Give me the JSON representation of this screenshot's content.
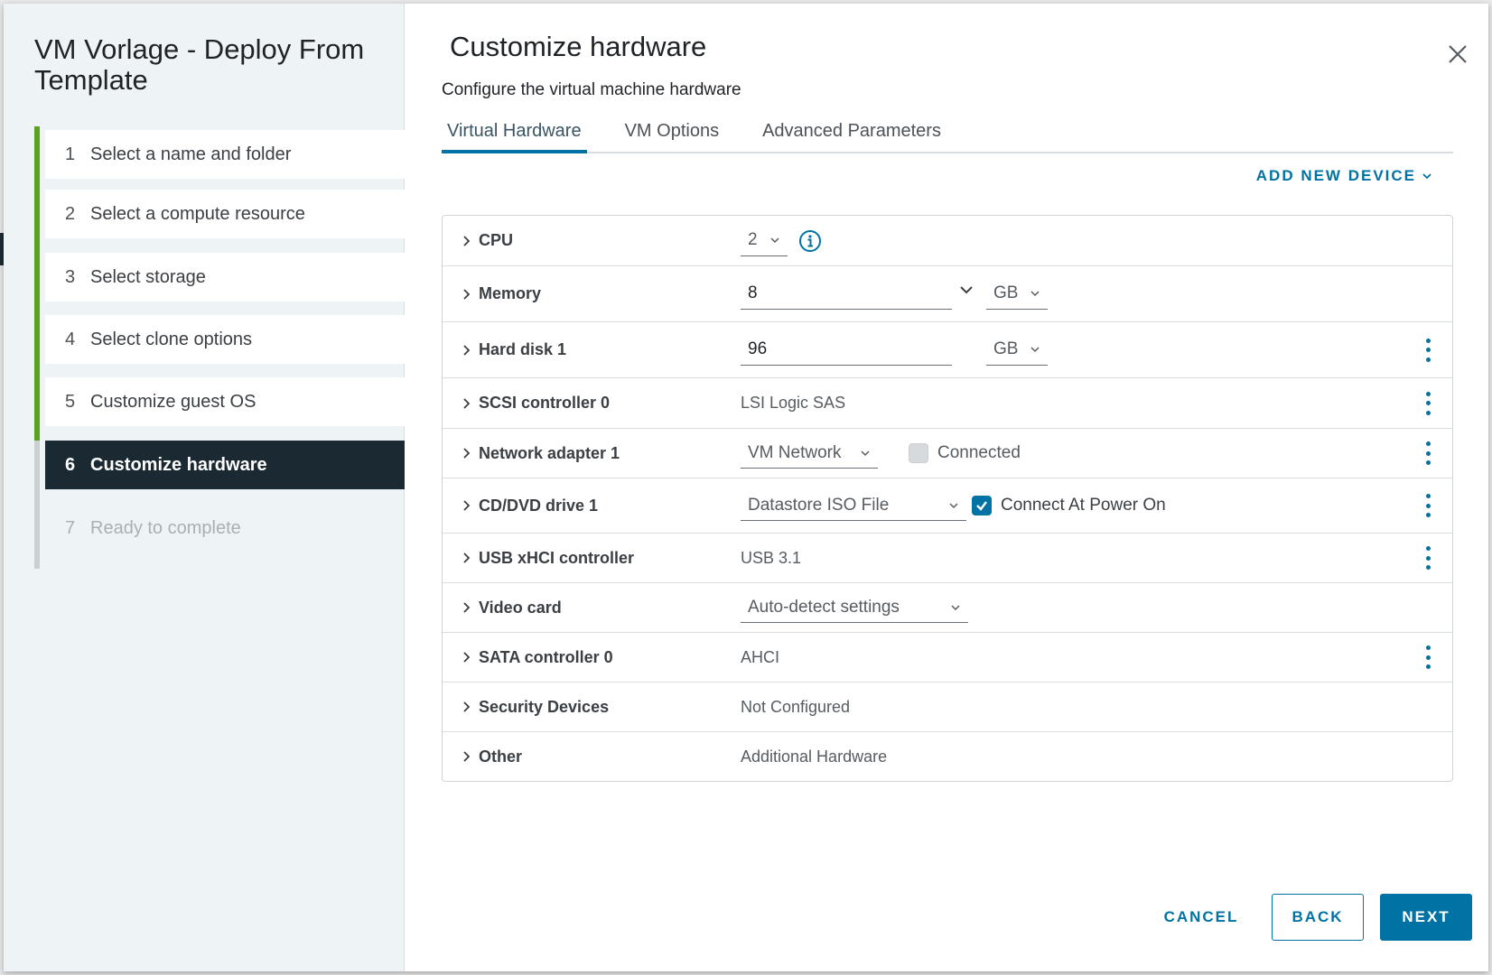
{
  "wizard": {
    "title": "VM Vorlage - Deploy From Template",
    "steps": [
      {
        "num": "1",
        "label": "Select a name and folder"
      },
      {
        "num": "2",
        "label": "Select a compute resource"
      },
      {
        "num": "3",
        "label": "Select storage"
      },
      {
        "num": "4",
        "label": "Select clone options"
      },
      {
        "num": "5",
        "label": "Customize guest OS"
      },
      {
        "num": "6",
        "label": "Customize hardware"
      },
      {
        "num": "7",
        "label": "Ready to complete"
      }
    ]
  },
  "main": {
    "title": "Customize hardware",
    "subtitle": "Configure the virtual machine hardware",
    "tabs": [
      "Virtual Hardware",
      "VM Options",
      "Advanced Parameters"
    ],
    "add_device": "ADD NEW DEVICE",
    "hardware": {
      "cpu": {
        "name": "CPU",
        "value": "2"
      },
      "memory": {
        "name": "Memory",
        "value": "8",
        "unit": "GB"
      },
      "hard_disk": {
        "name": "Hard disk 1",
        "value": "96",
        "unit": "GB"
      },
      "scsi": {
        "name": "SCSI controller 0",
        "value": "LSI Logic SAS"
      },
      "network": {
        "name": "Network adapter 1",
        "value": "VM Network",
        "checkbox_label": "Connected"
      },
      "cddvd": {
        "name": "CD/DVD drive 1",
        "value": "Datastore ISO File",
        "checkbox_label": "Connect At Power On"
      },
      "usb": {
        "name": "USB xHCI controller",
        "value": "USB 3.1"
      },
      "video": {
        "name": "Video card",
        "value": "Auto-detect settings"
      },
      "sata": {
        "name": "SATA controller 0",
        "value": "AHCI"
      },
      "security": {
        "name": "Security Devices",
        "value": "Not Configured"
      },
      "other": {
        "name": "Other",
        "value": "Additional Hardware"
      }
    }
  },
  "footer": {
    "cancel": "CANCEL",
    "back": "BACK",
    "next": "NEXT"
  },
  "colors": {
    "accent": "#0072a3",
    "progress": "#5aa220",
    "active_step": "#1b2a32"
  }
}
